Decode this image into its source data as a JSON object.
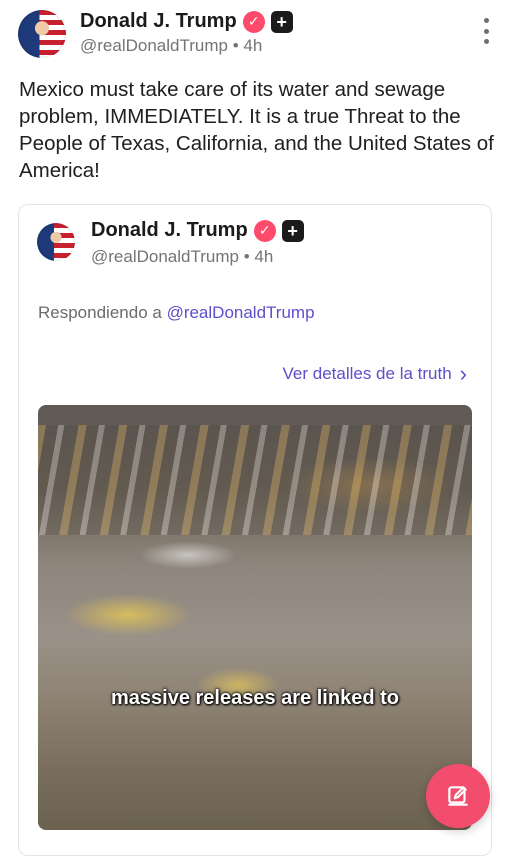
{
  "post": {
    "author_name": "Donald J. Trump",
    "handle": "@realDonaldTrump",
    "separator": "•",
    "time": "4h",
    "text": "Mexico must take care of its water and sewage problem, IMMEDIATELY. It is a true Threat to the People of Texas, California, and the United States of America!"
  },
  "quoted": {
    "author_name": "Donald J. Trump",
    "handle": "@realDonaldTrump",
    "separator": "•",
    "time": "4h",
    "reply_prefix": "Respondiendo a",
    "reply_target": "@realDonaldTrump",
    "details_link": "Ver detalles de la truth",
    "video_caption": "massive releases are linked to"
  },
  "colors": {
    "accent": "#5d4fc9",
    "verified": "#ff4b6b",
    "fab": "#f24d6c"
  },
  "icons": {
    "verified": "verified-check-icon",
    "plus": "plus-badge-icon",
    "more": "more-vertical-icon",
    "chevron": "chevron-right-icon",
    "compose": "compose-edit-icon"
  }
}
